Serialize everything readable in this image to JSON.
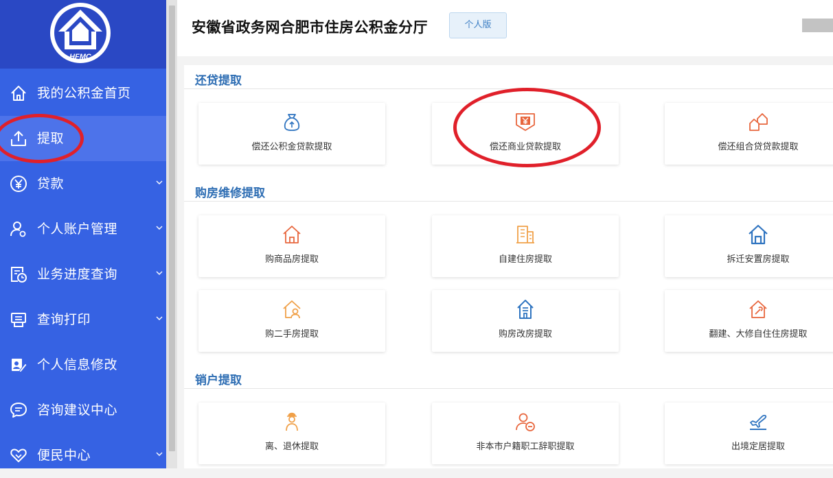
{
  "sidebar": {
    "logo_text": "HFMC",
    "items": [
      {
        "label": "我的公积金首页",
        "icon": "home-icon",
        "has_submenu": false,
        "active": false
      },
      {
        "label": "提取",
        "icon": "upload-icon",
        "has_submenu": false,
        "active": true
      },
      {
        "label": "贷款",
        "icon": "yen-coin-icon",
        "has_submenu": true,
        "active": false
      },
      {
        "label": "个人账户管理",
        "icon": "user-gear-icon",
        "has_submenu": true,
        "active": false
      },
      {
        "label": "业务进度查询",
        "icon": "progress-clock-icon",
        "has_submenu": true,
        "active": false
      },
      {
        "label": "查询打印",
        "icon": "printer-icon",
        "has_submenu": true,
        "active": false
      },
      {
        "label": "个人信息修改",
        "icon": "edit-profile-icon",
        "has_submenu": false,
        "active": false
      },
      {
        "label": "咨询建议中心",
        "icon": "chat-bubble-icon",
        "has_submenu": false,
        "active": false
      },
      {
        "label": "便民中心",
        "icon": "heart-icon",
        "has_submenu": true,
        "active": false
      }
    ]
  },
  "header": {
    "title": "安徽省政务网合肥市住房公积金分厅",
    "badge": "个人版"
  },
  "sections": [
    {
      "title": "还贷提取",
      "cards": [
        {
          "label": "偿还公积金贷款提取",
          "icon": "money-bag-icon",
          "color": "#2f74c0"
        },
        {
          "label": "偿还商业贷款提取",
          "icon": "yen-document-icon",
          "color": "#e8663d"
        },
        {
          "label": "偿还组合贷贷款提取",
          "icon": "combined-houses-icon",
          "color": "#e8663d"
        }
      ]
    },
    {
      "title": "购房维修提取",
      "cards": [
        {
          "label": "购商品房提取",
          "icon": "house-outline-icon",
          "color": "#e8663d"
        },
        {
          "label": "自建住房提取",
          "icon": "building-icon",
          "color": "#f0a048"
        },
        {
          "label": "拆迁安置房提取",
          "icon": "house-blue-icon",
          "color": "#2f74c0"
        },
        {
          "label": "购二手房提取",
          "icon": "house-person-icon",
          "color": "#f0a048"
        },
        {
          "label": "购房改房提取",
          "icon": "house-tall-icon",
          "color": "#2f74c0"
        },
        {
          "label": "翻建、大修自住住房提取",
          "icon": "house-repair-icon",
          "color": "#e8663d"
        }
      ]
    },
    {
      "title": "销户提取",
      "cards": [
        {
          "label": "离、退休提取",
          "icon": "retired-person-icon",
          "color": "#f0a048"
        },
        {
          "label": "非本市户籍职工辞职提取",
          "icon": "user-minus-icon",
          "color": "#e8663d"
        },
        {
          "label": "出境定居提取",
          "icon": "airplane-icon",
          "color": "#2f74c0"
        }
      ]
    }
  ],
  "colors": {
    "sidebar_bg": "#3662e3",
    "sidebar_active": "#4d73ea",
    "logo_bg": "#2a48c4",
    "section_title": "#2d6db3",
    "highlight_ring": "#e0202a"
  }
}
